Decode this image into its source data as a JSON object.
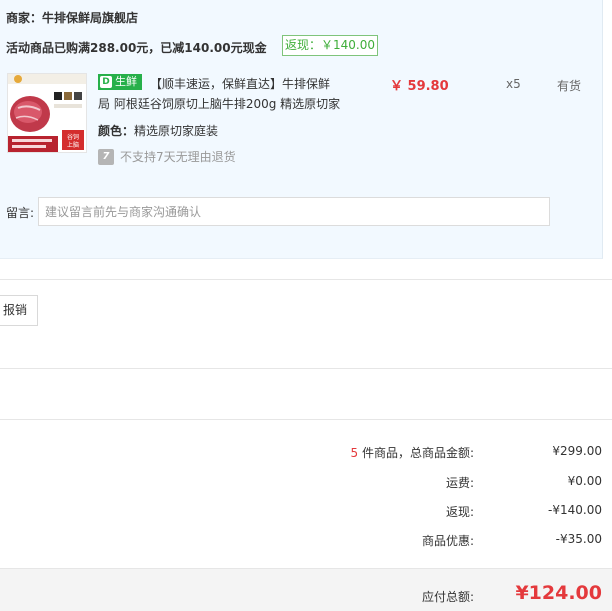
{
  "store": {
    "label": "商家：牛排保鲜局旗舰店"
  },
  "promo": {
    "text": "活动商品已购满288.00元，已减140.00元现金",
    "rebate_badge": "返现：￥140.00"
  },
  "product": {
    "fresh_tag": "生鲜",
    "fresh_tag_icon_text": "D",
    "title_line1": "【顺丰速运，保鲜直达】牛排保鲜",
    "title_line2": "局 阿根廷谷饲原切上脑牛排200g 精选原切家",
    "price": "￥ 59.80",
    "quantity": "x5",
    "stock": "有货",
    "color_key": "颜色：",
    "color_value": "精选原切家庭装",
    "return_icon_text": "7",
    "return_policy": "不支持7天无理由退货",
    "image_caption_1": "谷饲",
    "image_caption_2": "上脑"
  },
  "note": {
    "label": "留言:",
    "placeholder": "建议留言前先与商家沟通确认"
  },
  "invoice": {
    "button_label": "报销"
  },
  "summary": {
    "count": "5",
    "count_suffix": " 件商品，总商品金额:",
    "total_goods": "¥299.00",
    "shipping_label": "运费:",
    "shipping": "¥0.00",
    "rebate_label": "返现:",
    "rebate": "-¥140.00",
    "discount_label": "商品优惠:",
    "discount": "-¥35.00",
    "payable_label": "应付总额:",
    "payable": "¥124.00"
  }
}
